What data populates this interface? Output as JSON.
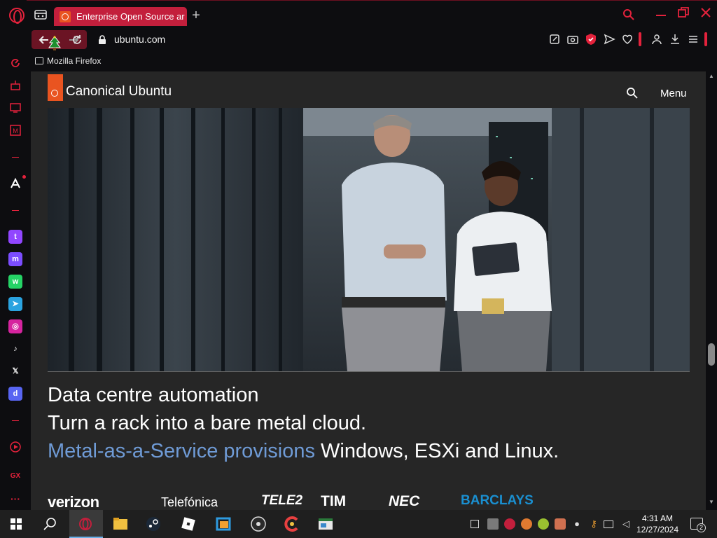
{
  "browser": {
    "tab_title": "Enterprise Open Source ar",
    "url": "ubuntu.com",
    "bookmark_label": "Mozilla Firefox",
    "accent_color": "#e4223c"
  },
  "site": {
    "brand": "Canonical Ubuntu",
    "menu_label": "Menu",
    "headline_1": "Data centre automation",
    "headline_2": "Turn a rack into a bare metal cloud.",
    "headline_3_link": "Metal-as-a-Service provisions",
    "headline_3_rest": " Windows, ESXi and Linux.",
    "customer_logos": [
      "verizon",
      "Telefónica",
      "TELE2",
      "TIM",
      "NEC",
      "BARCLAYS"
    ]
  },
  "sidebar_icons": [
    "speed-dial-icon",
    "ai-icon",
    "twitch-icon",
    "player-icon",
    "telegram-icon",
    "gx-icon"
  ],
  "sidebar_labels": {
    "gx": "GX",
    "more": "···"
  },
  "taskbar": {
    "time": "4:31 AM",
    "date": "12/27/2024",
    "notification_count": "2"
  }
}
